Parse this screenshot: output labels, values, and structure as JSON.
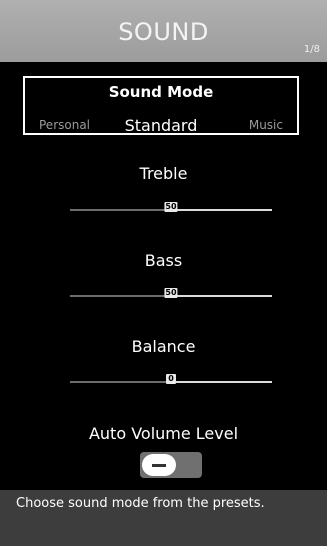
{
  "header": {
    "title": "SOUND",
    "page_indicator": "1/8"
  },
  "sound_mode": {
    "heading": "Sound Mode",
    "prev_option": "Personal",
    "selected": "Standard",
    "next_option": "Music"
  },
  "sliders": [
    {
      "label": "Treble",
      "value_text": "50",
      "fraction": 0.5
    },
    {
      "label": "Bass",
      "value_text": "50",
      "fraction": 0.5
    },
    {
      "label": "Balance",
      "value_text": "0",
      "fraction": 0.5
    }
  ],
  "auto_volume": {
    "label": "Auto Volume Level",
    "state": "off"
  },
  "footer": {
    "hint": "Choose sound mode from the presets."
  }
}
